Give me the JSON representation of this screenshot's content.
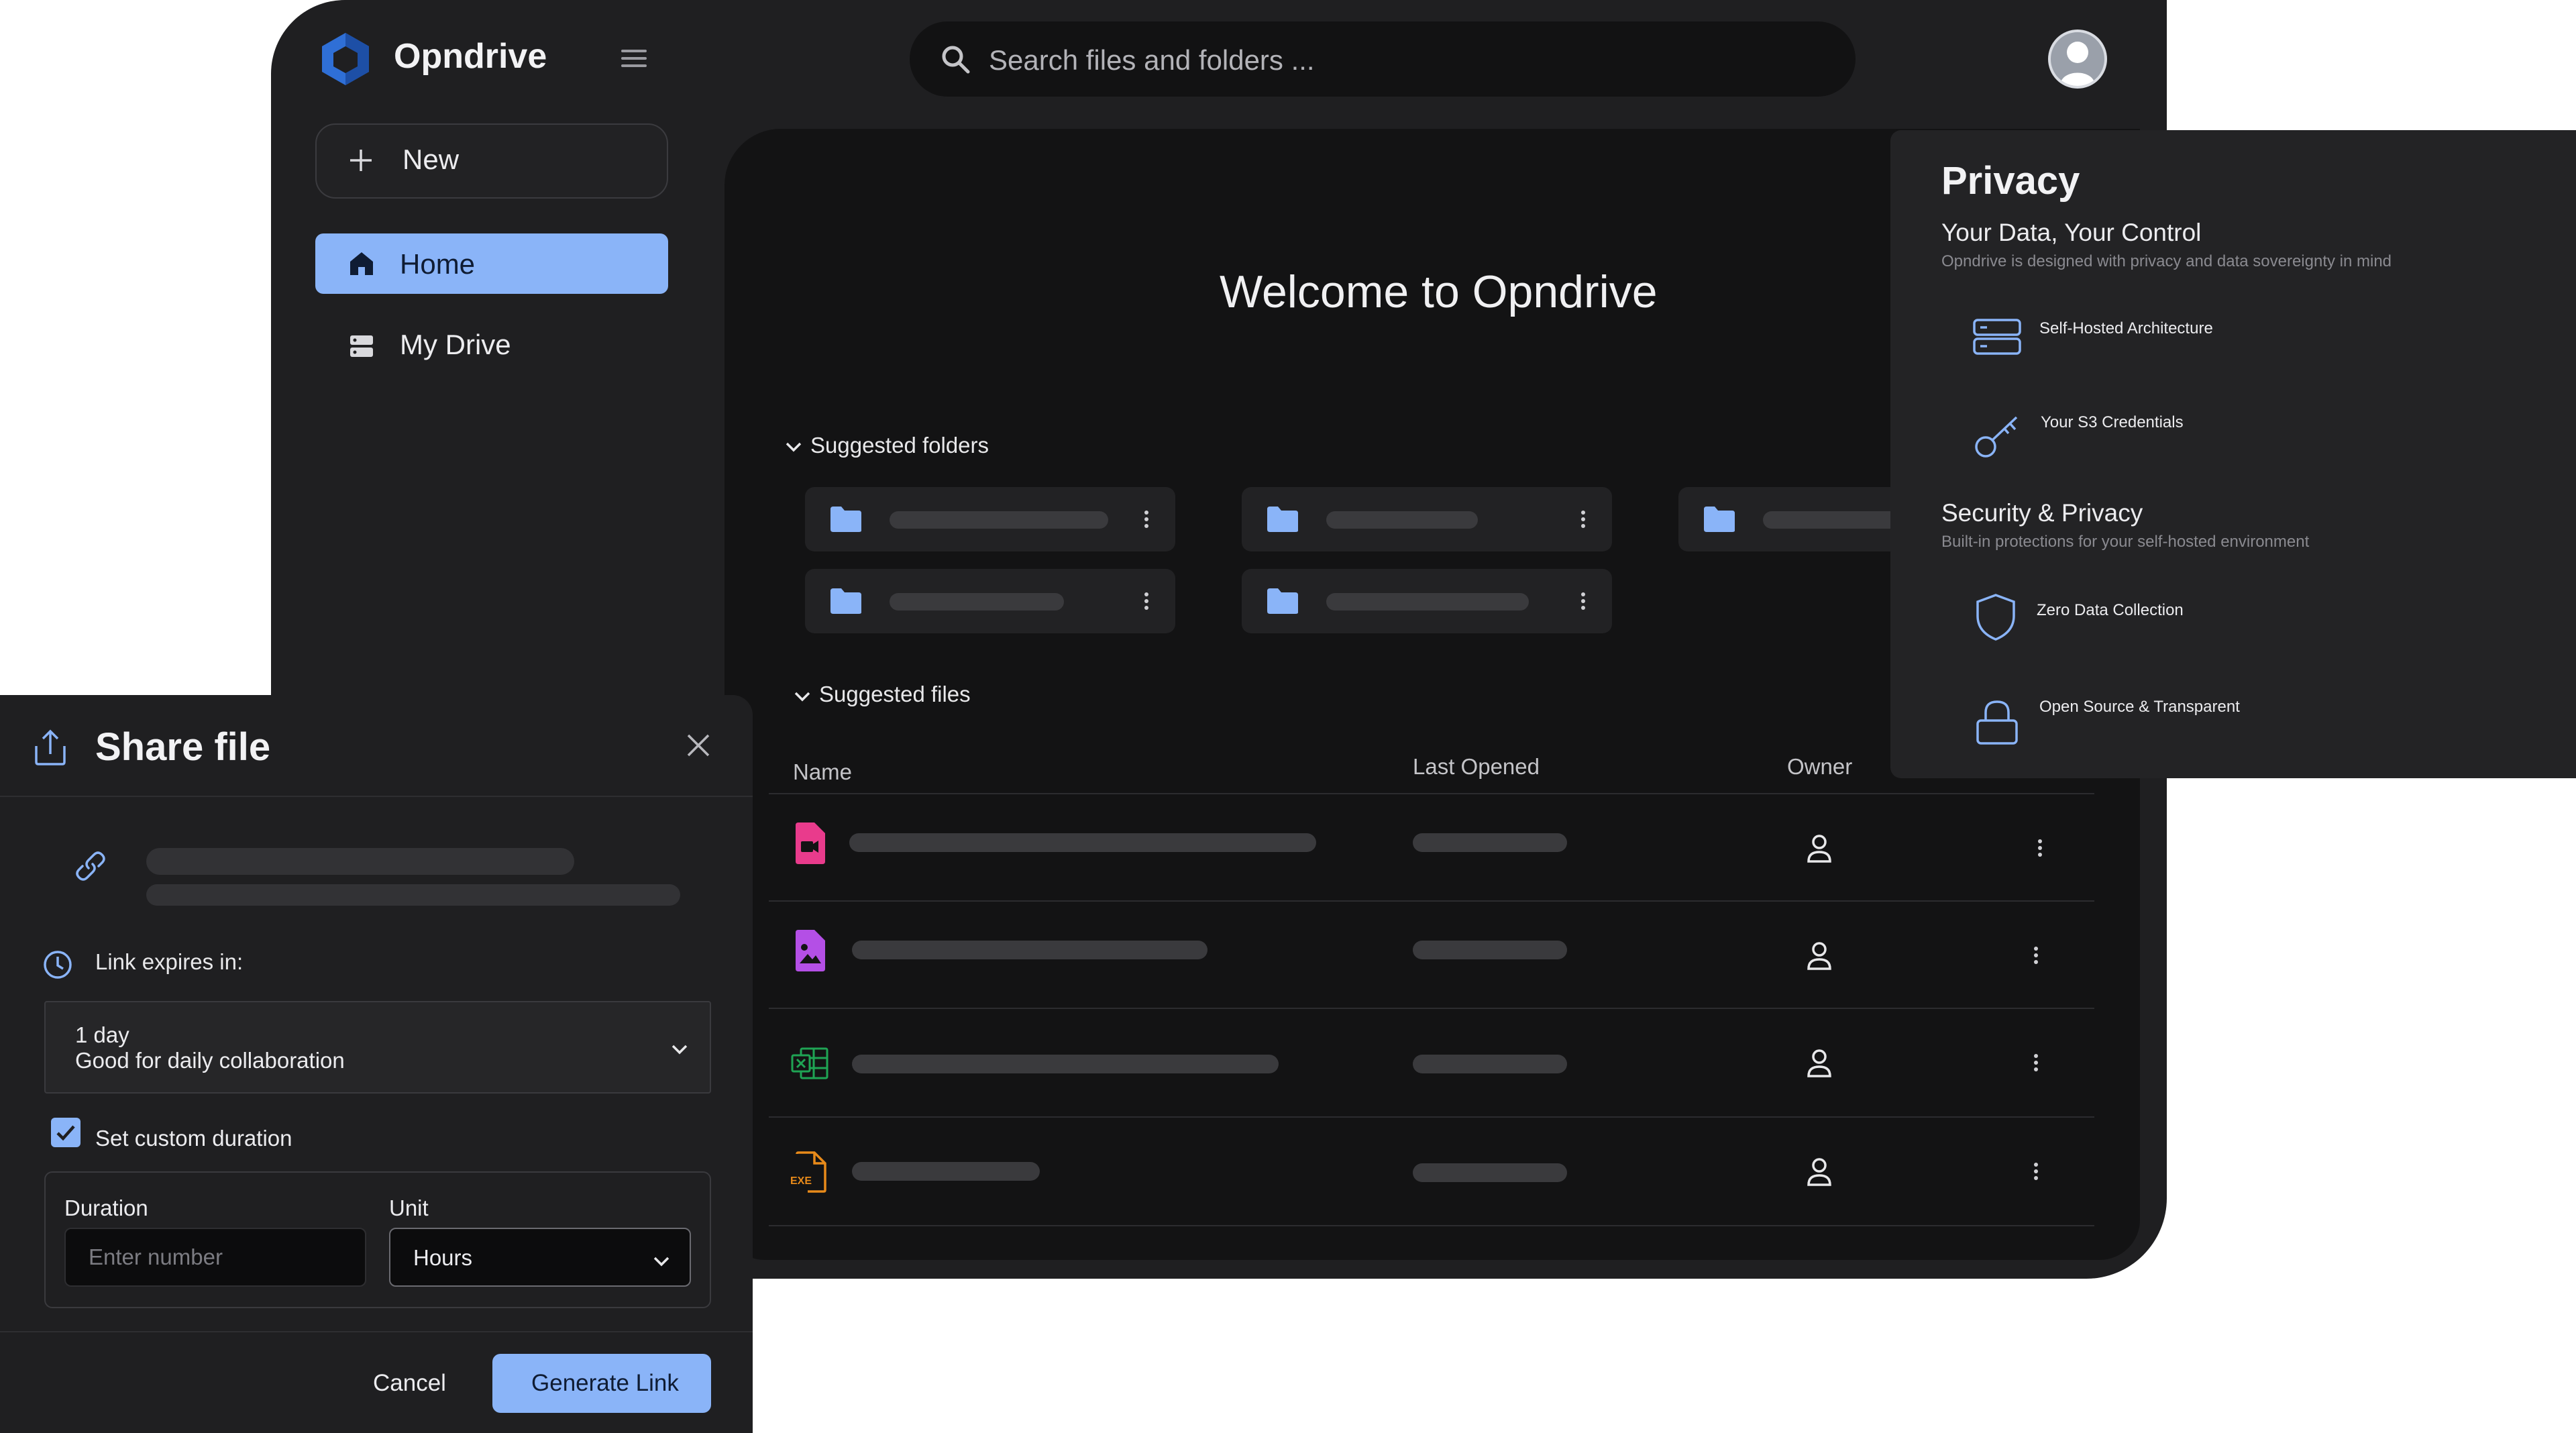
{
  "app": {
    "brand": "Opndrive",
    "search_placeholder": "Search files and folders ...",
    "new_label": "New",
    "nav": [
      {
        "label": "Home",
        "icon": "home-icon",
        "active": true
      },
      {
        "label": "My Drive",
        "icon": "drive-icon",
        "active": false
      }
    ],
    "accent_color": "#8ab4f8"
  },
  "main": {
    "welcome": "Welcome to Opndrive",
    "suggested_folders_label": "Suggested folders",
    "suggested_files_label": "Suggested files",
    "columns": {
      "name": "Name",
      "last_opened": "Last Opened",
      "owner": "Owner"
    },
    "file_types": [
      "video-file-icon",
      "image-file-icon",
      "excel-file-icon",
      "exe-file-icon"
    ],
    "exe_tag": "EXE"
  },
  "privacy": {
    "title": "Privacy",
    "section1_title": "Your Data, Your Control",
    "section1_desc": "Opndrive is designed with privacy and data sovereignty in mind",
    "item1": "Self-Hosted Architecture",
    "item2": "Your S3 Credentials",
    "section2_title": "Security & Privacy",
    "section2_desc": "Built-in protections for your self-hosted environment",
    "item3": "Zero Data Collection",
    "item4": "Open Source & Transparent"
  },
  "share_dialog": {
    "title": "Share file",
    "link_expires_label": "Link expires in:",
    "expiry_value": "1 day",
    "expiry_desc": "Good for daily collaboration",
    "custom_duration_label": "Set custom duration",
    "custom_duration_checked": true,
    "duration_label": "Duration",
    "duration_placeholder": "Enter number",
    "unit_label": "Unit",
    "unit_value": "Hours",
    "cancel_label": "Cancel",
    "generate_label": "Generate Link"
  }
}
